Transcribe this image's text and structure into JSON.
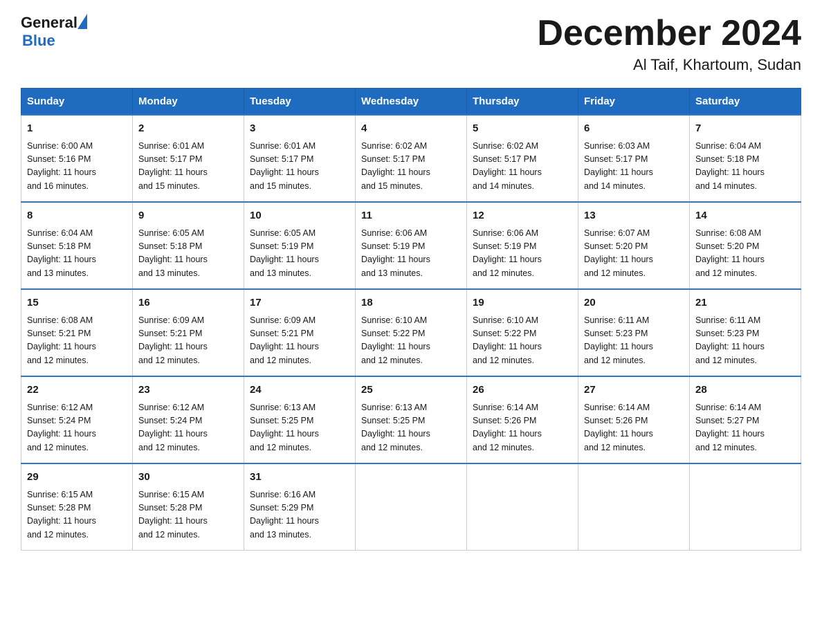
{
  "header": {
    "logo_general": "General",
    "logo_blue": "Blue",
    "month_title": "December 2024",
    "location": "Al Taif, Khartoum, Sudan"
  },
  "days_of_week": [
    "Sunday",
    "Monday",
    "Tuesday",
    "Wednesday",
    "Thursday",
    "Friday",
    "Saturday"
  ],
  "weeks": [
    [
      {
        "day": "1",
        "sunrise": "6:00 AM",
        "sunset": "5:16 PM",
        "daylight": "11 hours and 16 minutes."
      },
      {
        "day": "2",
        "sunrise": "6:01 AM",
        "sunset": "5:17 PM",
        "daylight": "11 hours and 15 minutes."
      },
      {
        "day": "3",
        "sunrise": "6:01 AM",
        "sunset": "5:17 PM",
        "daylight": "11 hours and 15 minutes."
      },
      {
        "day": "4",
        "sunrise": "6:02 AM",
        "sunset": "5:17 PM",
        "daylight": "11 hours and 15 minutes."
      },
      {
        "day": "5",
        "sunrise": "6:02 AM",
        "sunset": "5:17 PM",
        "daylight": "11 hours and 14 minutes."
      },
      {
        "day": "6",
        "sunrise": "6:03 AM",
        "sunset": "5:17 PM",
        "daylight": "11 hours and 14 minutes."
      },
      {
        "day": "7",
        "sunrise": "6:04 AM",
        "sunset": "5:18 PM",
        "daylight": "11 hours and 14 minutes."
      }
    ],
    [
      {
        "day": "8",
        "sunrise": "6:04 AM",
        "sunset": "5:18 PM",
        "daylight": "11 hours and 13 minutes."
      },
      {
        "day": "9",
        "sunrise": "6:05 AM",
        "sunset": "5:18 PM",
        "daylight": "11 hours and 13 minutes."
      },
      {
        "day": "10",
        "sunrise": "6:05 AM",
        "sunset": "5:19 PM",
        "daylight": "11 hours and 13 minutes."
      },
      {
        "day": "11",
        "sunrise": "6:06 AM",
        "sunset": "5:19 PM",
        "daylight": "11 hours and 13 minutes."
      },
      {
        "day": "12",
        "sunrise": "6:06 AM",
        "sunset": "5:19 PM",
        "daylight": "11 hours and 12 minutes."
      },
      {
        "day": "13",
        "sunrise": "6:07 AM",
        "sunset": "5:20 PM",
        "daylight": "11 hours and 12 minutes."
      },
      {
        "day": "14",
        "sunrise": "6:08 AM",
        "sunset": "5:20 PM",
        "daylight": "11 hours and 12 minutes."
      }
    ],
    [
      {
        "day": "15",
        "sunrise": "6:08 AM",
        "sunset": "5:21 PM",
        "daylight": "11 hours and 12 minutes."
      },
      {
        "day": "16",
        "sunrise": "6:09 AM",
        "sunset": "5:21 PM",
        "daylight": "11 hours and 12 minutes."
      },
      {
        "day": "17",
        "sunrise": "6:09 AM",
        "sunset": "5:21 PM",
        "daylight": "11 hours and 12 minutes."
      },
      {
        "day": "18",
        "sunrise": "6:10 AM",
        "sunset": "5:22 PM",
        "daylight": "11 hours and 12 minutes."
      },
      {
        "day": "19",
        "sunrise": "6:10 AM",
        "sunset": "5:22 PM",
        "daylight": "11 hours and 12 minutes."
      },
      {
        "day": "20",
        "sunrise": "6:11 AM",
        "sunset": "5:23 PM",
        "daylight": "11 hours and 12 minutes."
      },
      {
        "day": "21",
        "sunrise": "6:11 AM",
        "sunset": "5:23 PM",
        "daylight": "11 hours and 12 minutes."
      }
    ],
    [
      {
        "day": "22",
        "sunrise": "6:12 AM",
        "sunset": "5:24 PM",
        "daylight": "11 hours and 12 minutes."
      },
      {
        "day": "23",
        "sunrise": "6:12 AM",
        "sunset": "5:24 PM",
        "daylight": "11 hours and 12 minutes."
      },
      {
        "day": "24",
        "sunrise": "6:13 AM",
        "sunset": "5:25 PM",
        "daylight": "11 hours and 12 minutes."
      },
      {
        "day": "25",
        "sunrise": "6:13 AM",
        "sunset": "5:25 PM",
        "daylight": "11 hours and 12 minutes."
      },
      {
        "day": "26",
        "sunrise": "6:14 AM",
        "sunset": "5:26 PM",
        "daylight": "11 hours and 12 minutes."
      },
      {
        "day": "27",
        "sunrise": "6:14 AM",
        "sunset": "5:26 PM",
        "daylight": "11 hours and 12 minutes."
      },
      {
        "day": "28",
        "sunrise": "6:14 AM",
        "sunset": "5:27 PM",
        "daylight": "11 hours and 12 minutes."
      }
    ],
    [
      {
        "day": "29",
        "sunrise": "6:15 AM",
        "sunset": "5:28 PM",
        "daylight": "11 hours and 12 minutes."
      },
      {
        "day": "30",
        "sunrise": "6:15 AM",
        "sunset": "5:28 PM",
        "daylight": "11 hours and 12 minutes."
      },
      {
        "day": "31",
        "sunrise": "6:16 AM",
        "sunset": "5:29 PM",
        "daylight": "11 hours and 13 minutes."
      },
      null,
      null,
      null,
      null
    ]
  ],
  "labels": {
    "sunrise": "Sunrise:",
    "sunset": "Sunset:",
    "daylight": "Daylight:"
  }
}
